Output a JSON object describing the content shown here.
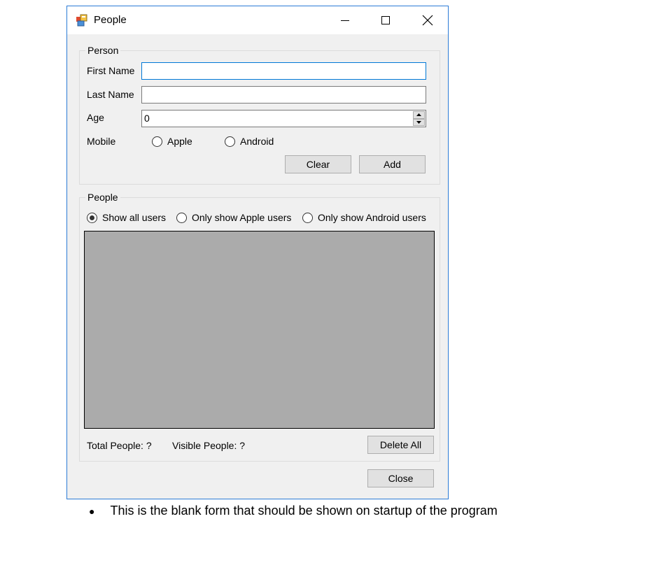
{
  "window": {
    "title": "People",
    "icon": "app-icon",
    "caption_buttons": [
      "minimize-icon",
      "maximize-icon",
      "close-icon"
    ]
  },
  "person_group": {
    "legend": "Person",
    "first_name_label": "First Name",
    "first_name_value": "",
    "last_name_label": "Last Name",
    "last_name_value": "",
    "age_label": "Age",
    "age_value": "0",
    "mobile_label": "Mobile",
    "mobile_options": [
      "Apple",
      "Android"
    ],
    "clear_label": "Clear",
    "add_label": "Add"
  },
  "people_group": {
    "legend": "People",
    "filter_options": [
      "Show all users",
      "Only show Apple users",
      "Only show Android users"
    ],
    "selected_filter": 0,
    "total_people": "Total People: ?",
    "visible_people": "Visible People: ?",
    "delete_all_label": "Delete All"
  },
  "close_label": "Close",
  "caption": {
    "bullet": "●",
    "text": "This is the blank form that should be shown on startup of the program"
  },
  "colors": {
    "window_border": "#2b7bd6",
    "form_background": "#f0f0f0",
    "listbox_background": "#ababab",
    "focus_border": "#0078d7"
  }
}
